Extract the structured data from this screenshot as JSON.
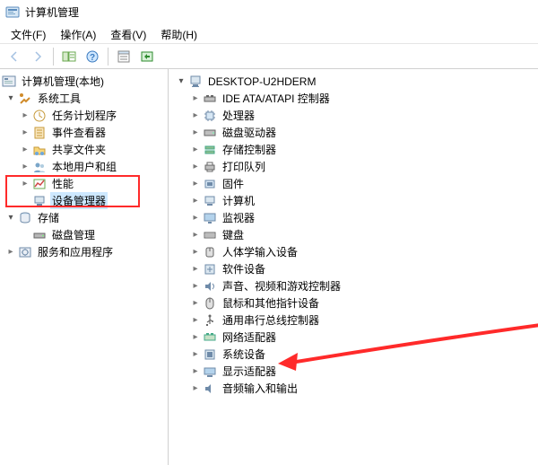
{
  "window": {
    "title": "计算机管理"
  },
  "menu": {
    "file": "文件(F)",
    "action": "操作(A)",
    "view": "查看(V)",
    "help": "帮助(H)"
  },
  "left_tree": {
    "root": "计算机管理(本地)",
    "sys_tools": "系统工具",
    "task_scheduler": "任务计划程序",
    "event_viewer": "事件查看器",
    "shared_folders": "共享文件夹",
    "local_users": "本地用户和组",
    "performance": "性能",
    "device_manager": "设备管理器",
    "storage": "存储",
    "disk_mgmt": "磁盘管理",
    "services_apps": "服务和应用程序"
  },
  "right_tree": {
    "root": "DESKTOP-U2HDERM",
    "ide": "IDE ATA/ATAPI 控制器",
    "cpu": "处理器",
    "disk_drive": "磁盘驱动器",
    "storage_ctrl": "存储控制器",
    "print_queue": "打印队列",
    "firmware": "固件",
    "computer": "计算机",
    "monitor": "监视器",
    "keyboard": "键盘",
    "hid": "人体学输入设备",
    "software": "软件设备",
    "sound": "声音、视频和游戏控制器",
    "mouse": "鼠标和其他指针设备",
    "usb": "通用串行总线控制器",
    "network": "网络适配器",
    "sys_dev": "系统设备",
    "display": "显示适配器",
    "audio_io": "音频输入和输出"
  }
}
